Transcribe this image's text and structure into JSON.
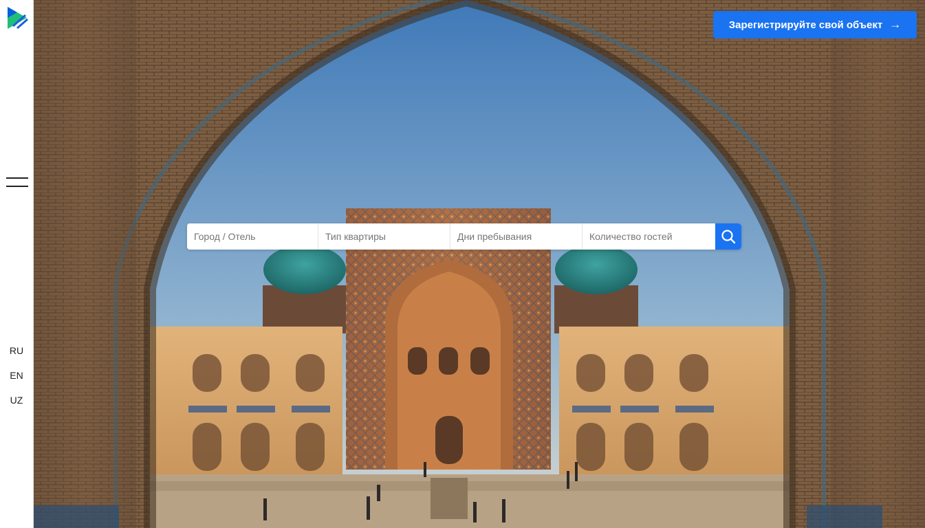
{
  "header": {
    "register_label": "Зарегистрируйте свой объект",
    "register_arrow": "→"
  },
  "search": {
    "city_placeholder": "Город / Отель",
    "apartment_type_placeholder": "Тип квартиры",
    "stay_days_placeholder": "Дни пребывания",
    "guests_placeholder": "Количество гостей"
  },
  "languages": [
    "RU",
    "EN",
    "UZ"
  ],
  "colors": {
    "accent": "#1a73f0",
    "sky_top": "#4f86c0",
    "sky_bottom": "#c9d6dc",
    "tile_turquoise": "#2f8a8c",
    "brick": "#8a6a4a"
  },
  "icons": {
    "logo": "triangular-logo-icon",
    "menu": "hamburger-menu-icon",
    "search": "search-icon"
  }
}
